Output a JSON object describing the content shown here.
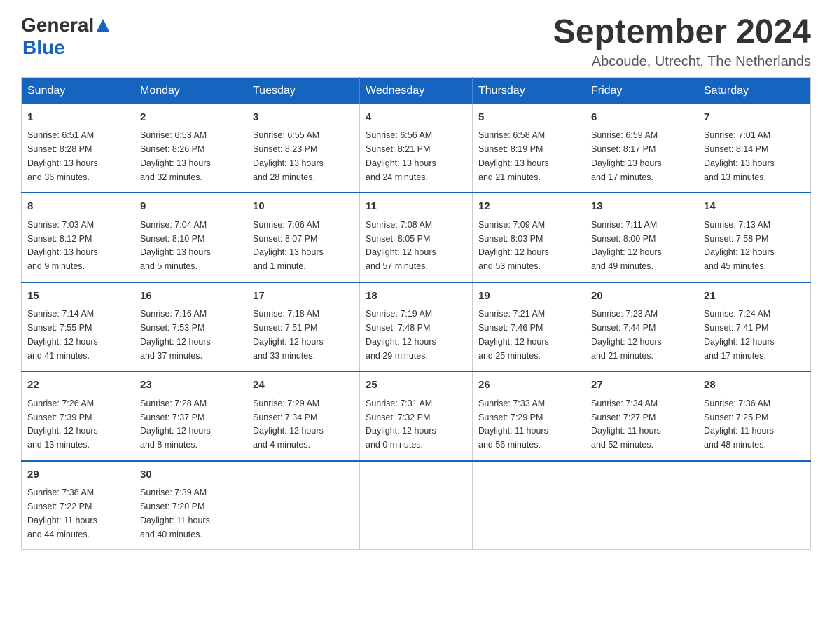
{
  "header": {
    "logo_general": "General",
    "logo_blue": "Blue",
    "title": "September 2024",
    "location": "Abcoude, Utrecht, The Netherlands"
  },
  "days_of_week": [
    "Sunday",
    "Monday",
    "Tuesday",
    "Wednesday",
    "Thursday",
    "Friday",
    "Saturday"
  ],
  "weeks": [
    [
      {
        "day": "1",
        "sunrise": "6:51 AM",
        "sunset": "8:28 PM",
        "daylight": "13 hours and 36 minutes."
      },
      {
        "day": "2",
        "sunrise": "6:53 AM",
        "sunset": "8:26 PM",
        "daylight": "13 hours and 32 minutes."
      },
      {
        "day": "3",
        "sunrise": "6:55 AM",
        "sunset": "8:23 PM",
        "daylight": "13 hours and 28 minutes."
      },
      {
        "day": "4",
        "sunrise": "6:56 AM",
        "sunset": "8:21 PM",
        "daylight": "13 hours and 24 minutes."
      },
      {
        "day": "5",
        "sunrise": "6:58 AM",
        "sunset": "8:19 PM",
        "daylight": "13 hours and 21 minutes."
      },
      {
        "day": "6",
        "sunrise": "6:59 AM",
        "sunset": "8:17 PM",
        "daylight": "13 hours and 17 minutes."
      },
      {
        "day": "7",
        "sunrise": "7:01 AM",
        "sunset": "8:14 PM",
        "daylight": "13 hours and 13 minutes."
      }
    ],
    [
      {
        "day": "8",
        "sunrise": "7:03 AM",
        "sunset": "8:12 PM",
        "daylight": "13 hours and 9 minutes."
      },
      {
        "day": "9",
        "sunrise": "7:04 AM",
        "sunset": "8:10 PM",
        "daylight": "13 hours and 5 minutes."
      },
      {
        "day": "10",
        "sunrise": "7:06 AM",
        "sunset": "8:07 PM",
        "daylight": "13 hours and 1 minute."
      },
      {
        "day": "11",
        "sunrise": "7:08 AM",
        "sunset": "8:05 PM",
        "daylight": "12 hours and 57 minutes."
      },
      {
        "day": "12",
        "sunrise": "7:09 AM",
        "sunset": "8:03 PM",
        "daylight": "12 hours and 53 minutes."
      },
      {
        "day": "13",
        "sunrise": "7:11 AM",
        "sunset": "8:00 PM",
        "daylight": "12 hours and 49 minutes."
      },
      {
        "day": "14",
        "sunrise": "7:13 AM",
        "sunset": "7:58 PM",
        "daylight": "12 hours and 45 minutes."
      }
    ],
    [
      {
        "day": "15",
        "sunrise": "7:14 AM",
        "sunset": "7:55 PM",
        "daylight": "12 hours and 41 minutes."
      },
      {
        "day": "16",
        "sunrise": "7:16 AM",
        "sunset": "7:53 PM",
        "daylight": "12 hours and 37 minutes."
      },
      {
        "day": "17",
        "sunrise": "7:18 AM",
        "sunset": "7:51 PM",
        "daylight": "12 hours and 33 minutes."
      },
      {
        "day": "18",
        "sunrise": "7:19 AM",
        "sunset": "7:48 PM",
        "daylight": "12 hours and 29 minutes."
      },
      {
        "day": "19",
        "sunrise": "7:21 AM",
        "sunset": "7:46 PM",
        "daylight": "12 hours and 25 minutes."
      },
      {
        "day": "20",
        "sunrise": "7:23 AM",
        "sunset": "7:44 PM",
        "daylight": "12 hours and 21 minutes."
      },
      {
        "day": "21",
        "sunrise": "7:24 AM",
        "sunset": "7:41 PM",
        "daylight": "12 hours and 17 minutes."
      }
    ],
    [
      {
        "day": "22",
        "sunrise": "7:26 AM",
        "sunset": "7:39 PM",
        "daylight": "12 hours and 13 minutes."
      },
      {
        "day": "23",
        "sunrise": "7:28 AM",
        "sunset": "7:37 PM",
        "daylight": "12 hours and 8 minutes."
      },
      {
        "day": "24",
        "sunrise": "7:29 AM",
        "sunset": "7:34 PM",
        "daylight": "12 hours and 4 minutes."
      },
      {
        "day": "25",
        "sunrise": "7:31 AM",
        "sunset": "7:32 PM",
        "daylight": "12 hours and 0 minutes."
      },
      {
        "day": "26",
        "sunrise": "7:33 AM",
        "sunset": "7:29 PM",
        "daylight": "11 hours and 56 minutes."
      },
      {
        "day": "27",
        "sunrise": "7:34 AM",
        "sunset": "7:27 PM",
        "daylight": "11 hours and 52 minutes."
      },
      {
        "day": "28",
        "sunrise": "7:36 AM",
        "sunset": "7:25 PM",
        "daylight": "11 hours and 48 minutes."
      }
    ],
    [
      {
        "day": "29",
        "sunrise": "7:38 AM",
        "sunset": "7:22 PM",
        "daylight": "11 hours and 44 minutes."
      },
      {
        "day": "30",
        "sunrise": "7:39 AM",
        "sunset": "7:20 PM",
        "daylight": "11 hours and 40 minutes."
      },
      null,
      null,
      null,
      null,
      null
    ]
  ],
  "labels": {
    "sunrise": "Sunrise:",
    "sunset": "Sunset:",
    "daylight": "Daylight:"
  }
}
